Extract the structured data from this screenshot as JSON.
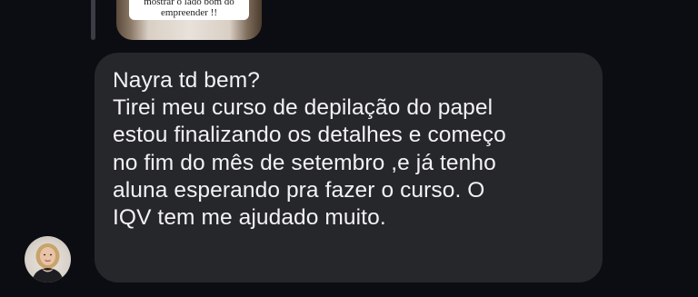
{
  "story_reply": {
    "caption_lines": [
      "mostrar o lado bom do",
      "empreender !!"
    ]
  },
  "message": {
    "lines": [
      "Nayra td bem?",
      "Tirei meu curso de depilação do papel",
      "estou finalizando os detalhes e começo",
      "no fim do mês de setembro ,e já tenho",
      "aluna esperando pra fazer o curso. O",
      "IQV tem me ajudado muito."
    ]
  },
  "sender": {
    "avatar_icon": "profile-photo"
  },
  "colors": {
    "background": "#0b0d12",
    "bubble": "#26272b",
    "text": "#f2f2f4"
  }
}
